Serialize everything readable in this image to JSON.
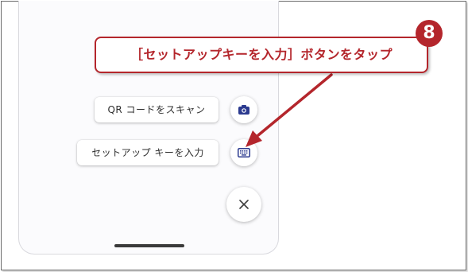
{
  "callout": {
    "step_number": "8",
    "text": "［セットアップキーを入力］ボタンをタップ",
    "color": "#b4262c"
  },
  "menu": {
    "scan_qr_label": "QR コードをスキャン",
    "scan_qr_icon": "camera-icon",
    "enter_key_label": "セットアップ キーを入力",
    "enter_key_icon": "keyboard-icon",
    "close_icon": "close-icon",
    "accent_color": "#2b3a8f"
  }
}
